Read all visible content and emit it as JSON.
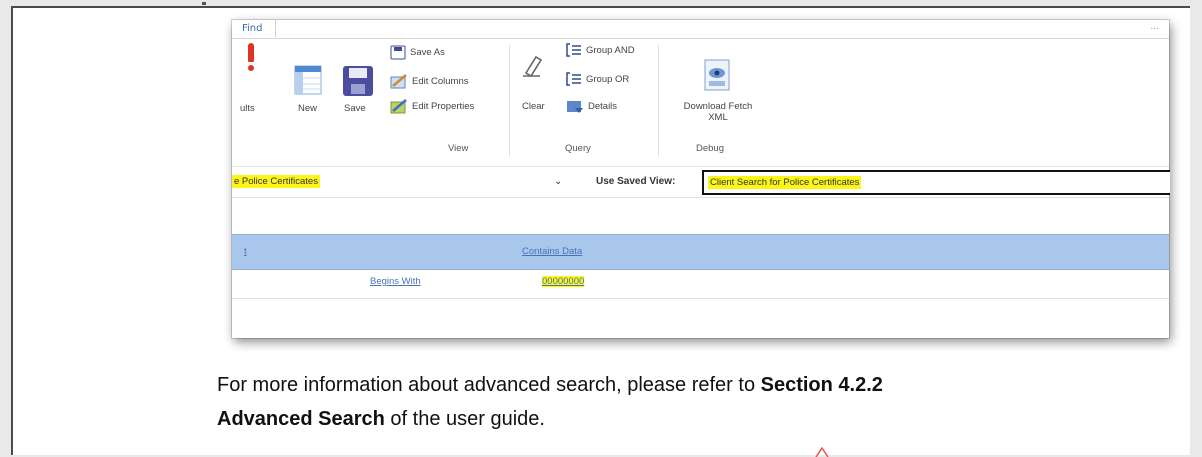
{
  "ribbon": {
    "tab_label": "Find",
    "top_right": "...",
    "results_label": "ults",
    "new_label": "New",
    "save_label": "Save",
    "save_as_label": "Save As",
    "edit_columns_label": "Edit Columns",
    "edit_properties_label": "Edit Properties",
    "clear_label": "Clear",
    "group_and_label": "Group AND",
    "group_or_label": "Group OR",
    "details_label": "Details",
    "download_fetch_label": "Download Fetch",
    "download_xml_label": "XML",
    "groups": {
      "view": "View",
      "query": "Query",
      "debug": "Debug"
    }
  },
  "find": {
    "entity_value": "e Police Certificates",
    "saved_view_label": "Use Saved View:",
    "saved_view_value": "Client Search for Police Certificates"
  },
  "grid": {
    "header_left": "t",
    "header_condition": "Contains Data",
    "row_operator": "Begins With",
    "row_value": "00000000"
  },
  "caption": {
    "line1_prefix": "For more information about advanced search, please refer to ",
    "line1_bold": "Section 4.2.2",
    "line2_bold": "Advanced Search",
    "line2_suffix": " of the user guide."
  },
  "colors": {
    "highlight": "#fbf518",
    "grid_header": "#a9c6eb",
    "link": "#4a72b5",
    "results_icon": "#e03225"
  }
}
